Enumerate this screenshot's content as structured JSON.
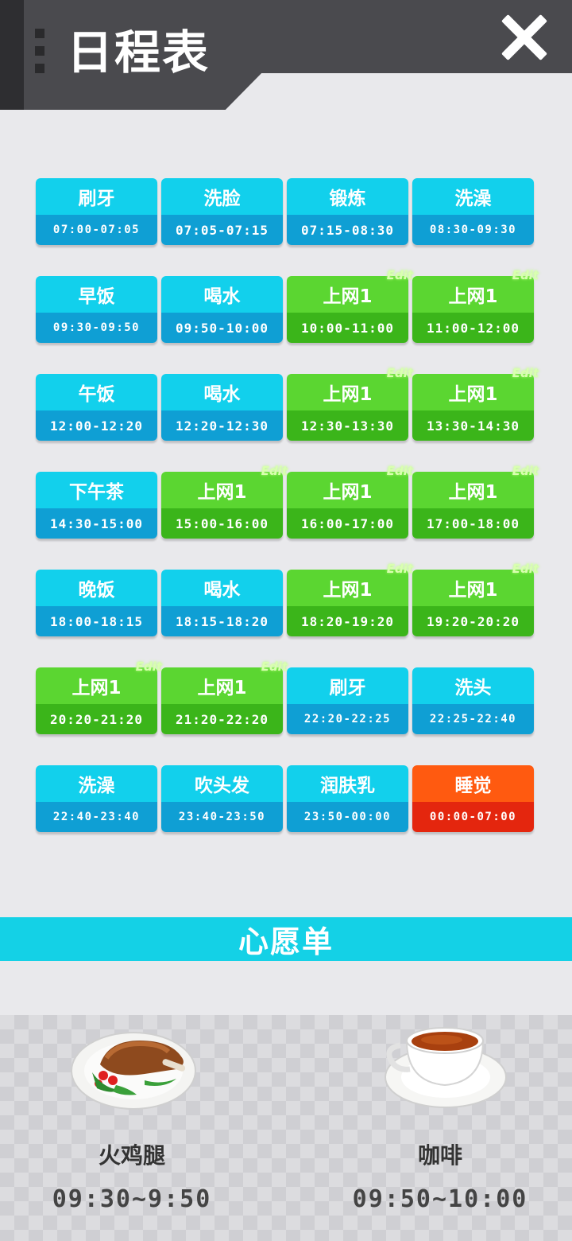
{
  "header": {
    "title": "日程表",
    "close_icon": "close-icon"
  },
  "schedule": [
    {
      "label": "刷牙",
      "time": "07:00-07:05",
      "color": "blue",
      "edit": false
    },
    {
      "label": "洗脸",
      "time": "07:05-07:15",
      "color": "blue",
      "edit": false
    },
    {
      "label": "锻炼",
      "time": "07:15-08:30",
      "color": "blue",
      "edit": false
    },
    {
      "label": "洗澡",
      "time": "08:30-09:30",
      "color": "blue",
      "edit": false
    },
    {
      "label": "早饭",
      "time": "09:30-09:50",
      "color": "blue",
      "edit": false
    },
    {
      "label": "喝水",
      "time": "09:50-10:00",
      "color": "blue",
      "edit": false
    },
    {
      "label": "上网1",
      "time": "10:00-11:00",
      "color": "green",
      "edit": true
    },
    {
      "label": "上网1",
      "time": "11:00-12:00",
      "color": "green",
      "edit": true
    },
    {
      "label": "午饭",
      "time": "12:00-12:20",
      "color": "blue",
      "edit": false
    },
    {
      "label": "喝水",
      "time": "12:20-12:30",
      "color": "blue",
      "edit": false
    },
    {
      "label": "上网1",
      "time": "12:30-13:30",
      "color": "green",
      "edit": true
    },
    {
      "label": "上网1",
      "time": "13:30-14:30",
      "color": "green",
      "edit": true
    },
    {
      "label": "下午茶",
      "time": "14:30-15:00",
      "color": "blue",
      "edit": false
    },
    {
      "label": "上网1",
      "time": "15:00-16:00",
      "color": "green",
      "edit": true
    },
    {
      "label": "上网1",
      "time": "16:00-17:00",
      "color": "green",
      "edit": true
    },
    {
      "label": "上网1",
      "time": "17:00-18:00",
      "color": "green",
      "edit": true
    },
    {
      "label": "晚饭",
      "time": "18:00-18:15",
      "color": "blue",
      "edit": false
    },
    {
      "label": "喝水",
      "time": "18:15-18:20",
      "color": "blue",
      "edit": false
    },
    {
      "label": "上网1",
      "time": "18:20-19:20",
      "color": "green",
      "edit": true
    },
    {
      "label": "上网1",
      "time": "19:20-20:20",
      "color": "green",
      "edit": true
    },
    {
      "label": "上网1",
      "time": "20:20-21:20",
      "color": "green",
      "edit": true
    },
    {
      "label": "上网1",
      "time": "21:20-22:20",
      "color": "green",
      "edit": true
    },
    {
      "label": "刷牙",
      "time": "22:20-22:25",
      "color": "blue",
      "edit": false
    },
    {
      "label": "洗头",
      "time": "22:25-22:40",
      "color": "blue",
      "edit": false
    },
    {
      "label": "洗澡",
      "time": "22:40-23:40",
      "color": "blue",
      "edit": false
    },
    {
      "label": "吹头发",
      "time": "23:40-23:50",
      "color": "blue",
      "edit": false
    },
    {
      "label": "润肤乳",
      "time": "23:50-00:00",
      "color": "blue",
      "edit": false
    },
    {
      "label": "睡觉",
      "time": "00:00-07:00",
      "color": "red",
      "edit": false
    }
  ],
  "edit_label": "Edit",
  "wishlist": {
    "title": "心愿单",
    "items": [
      {
        "name": "火鸡腿",
        "time": "09:30~9:50",
        "icon": "turkey-leg-icon"
      },
      {
        "name": "咖啡",
        "time": "09:50~10:00",
        "icon": "coffee-cup-icon"
      }
    ]
  }
}
